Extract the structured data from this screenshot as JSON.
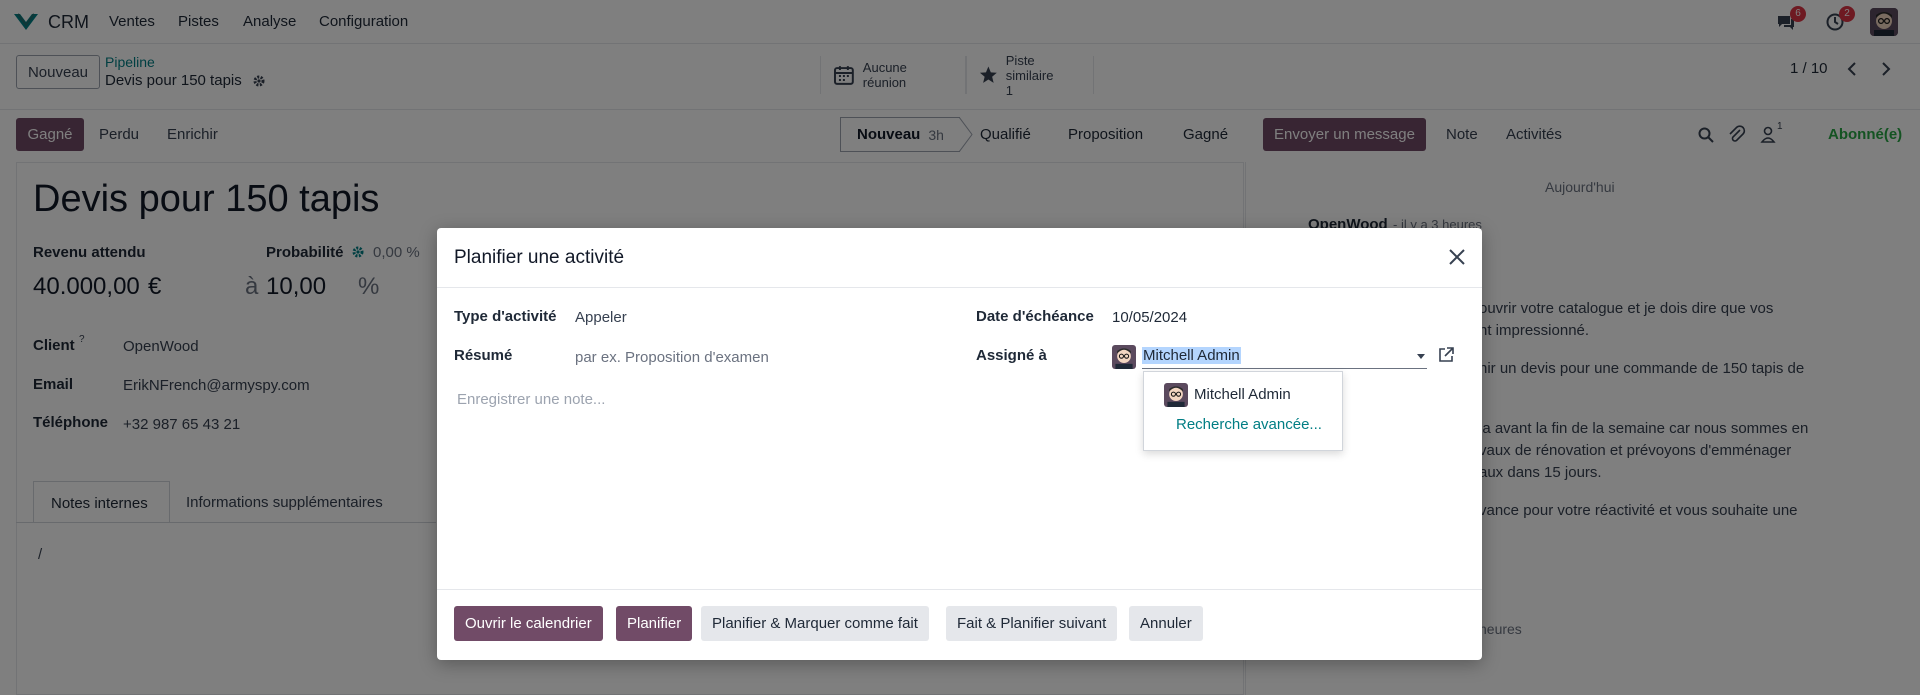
{
  "navbar": {
    "app_name": "CRM",
    "menus": [
      "Ventes",
      "Pistes",
      "Analyse",
      "Configuration"
    ],
    "messages_count": "6",
    "activities_count": "2"
  },
  "control_panel": {
    "new_button": "Nouveau",
    "breadcrumb_parent": "Pipeline",
    "breadcrumb_current": "Devis pour 150 tapis",
    "smart_meetings": "Aucune réunion",
    "smart_similar_label": "Piste similaire",
    "smart_similar_count": "1",
    "pager": "1 / 10"
  },
  "actions": {
    "won": "Gagné",
    "lost": "Perdu",
    "enrich": "Enrichir"
  },
  "stages": {
    "current": "Nouveau",
    "current_duration": "3h",
    "others": [
      "Qualifié",
      "Proposition",
      "Gagné"
    ]
  },
  "chatter": {
    "send_message": "Envoyer un message",
    "note": "Note",
    "activities": "Activités",
    "followers_count": "1",
    "subscribed": "Abonné(e)",
    "date_separator": "Aujourd'hui",
    "author": "OpenWood",
    "time_ago": "- il y a 3 heures",
    "body_lines": [
      "ouvrir votre catalogue et je dois dire que vos",
      "nt impressionné.",
      "nir un devis pour une commande de 150 tapis de",
      "la avant la fin de la semaine car nous sommes en",
      "vaux de rénovation et prévoyons d'emménager",
      "aux dans 15 jours.",
      "vance pour votre réactivité et vous souhaite une",
      "."
    ],
    "footer_time": "heures"
  },
  "record": {
    "title": "Devis pour 150 tapis",
    "expected_revenue_label": "Revenu attendu",
    "expected_revenue": "40.000,00",
    "currency": "€",
    "at": "à",
    "probability_label": "Probabilité",
    "probability_auto": "0,00 %",
    "probability": "10,00",
    "percent": "%",
    "client_label": "Client",
    "client_help": "?",
    "client": "OpenWood",
    "email_label": "Email",
    "email": "ErikNFrench@armyspy.com",
    "phone_label": "Téléphone",
    "phone": "+32 987 65 43 21",
    "tab_internal_notes": "Notes internes",
    "tab_extra_info": "Informations supplémentaires",
    "notes_content": "/"
  },
  "modal": {
    "title": "Planifier une activité",
    "activity_type_label": "Type d'activité",
    "activity_type": "Appeler",
    "summary_label": "Résumé",
    "summary_placeholder": "par ex. Proposition d'examen",
    "due_date_label": "Date d'échéance",
    "due_date": "10/05/2024",
    "assigned_label": "Assigné à",
    "assigned_to": "Mitchell Admin",
    "note_placeholder": "Enregistrer une note...",
    "dropdown_option": "Mitchell Admin",
    "dropdown_advanced": "Recherche avancée...",
    "btn_calendar": "Ouvrir le calendrier",
    "btn_schedule": "Planifier",
    "btn_schedule_done": "Planifier & Marquer comme fait",
    "btn_done_next": "Fait & Planifier suivant",
    "btn_cancel": "Annuler"
  },
  "colors": {
    "primary": "#714b67",
    "link": "#017e84",
    "success": "#28a745"
  }
}
